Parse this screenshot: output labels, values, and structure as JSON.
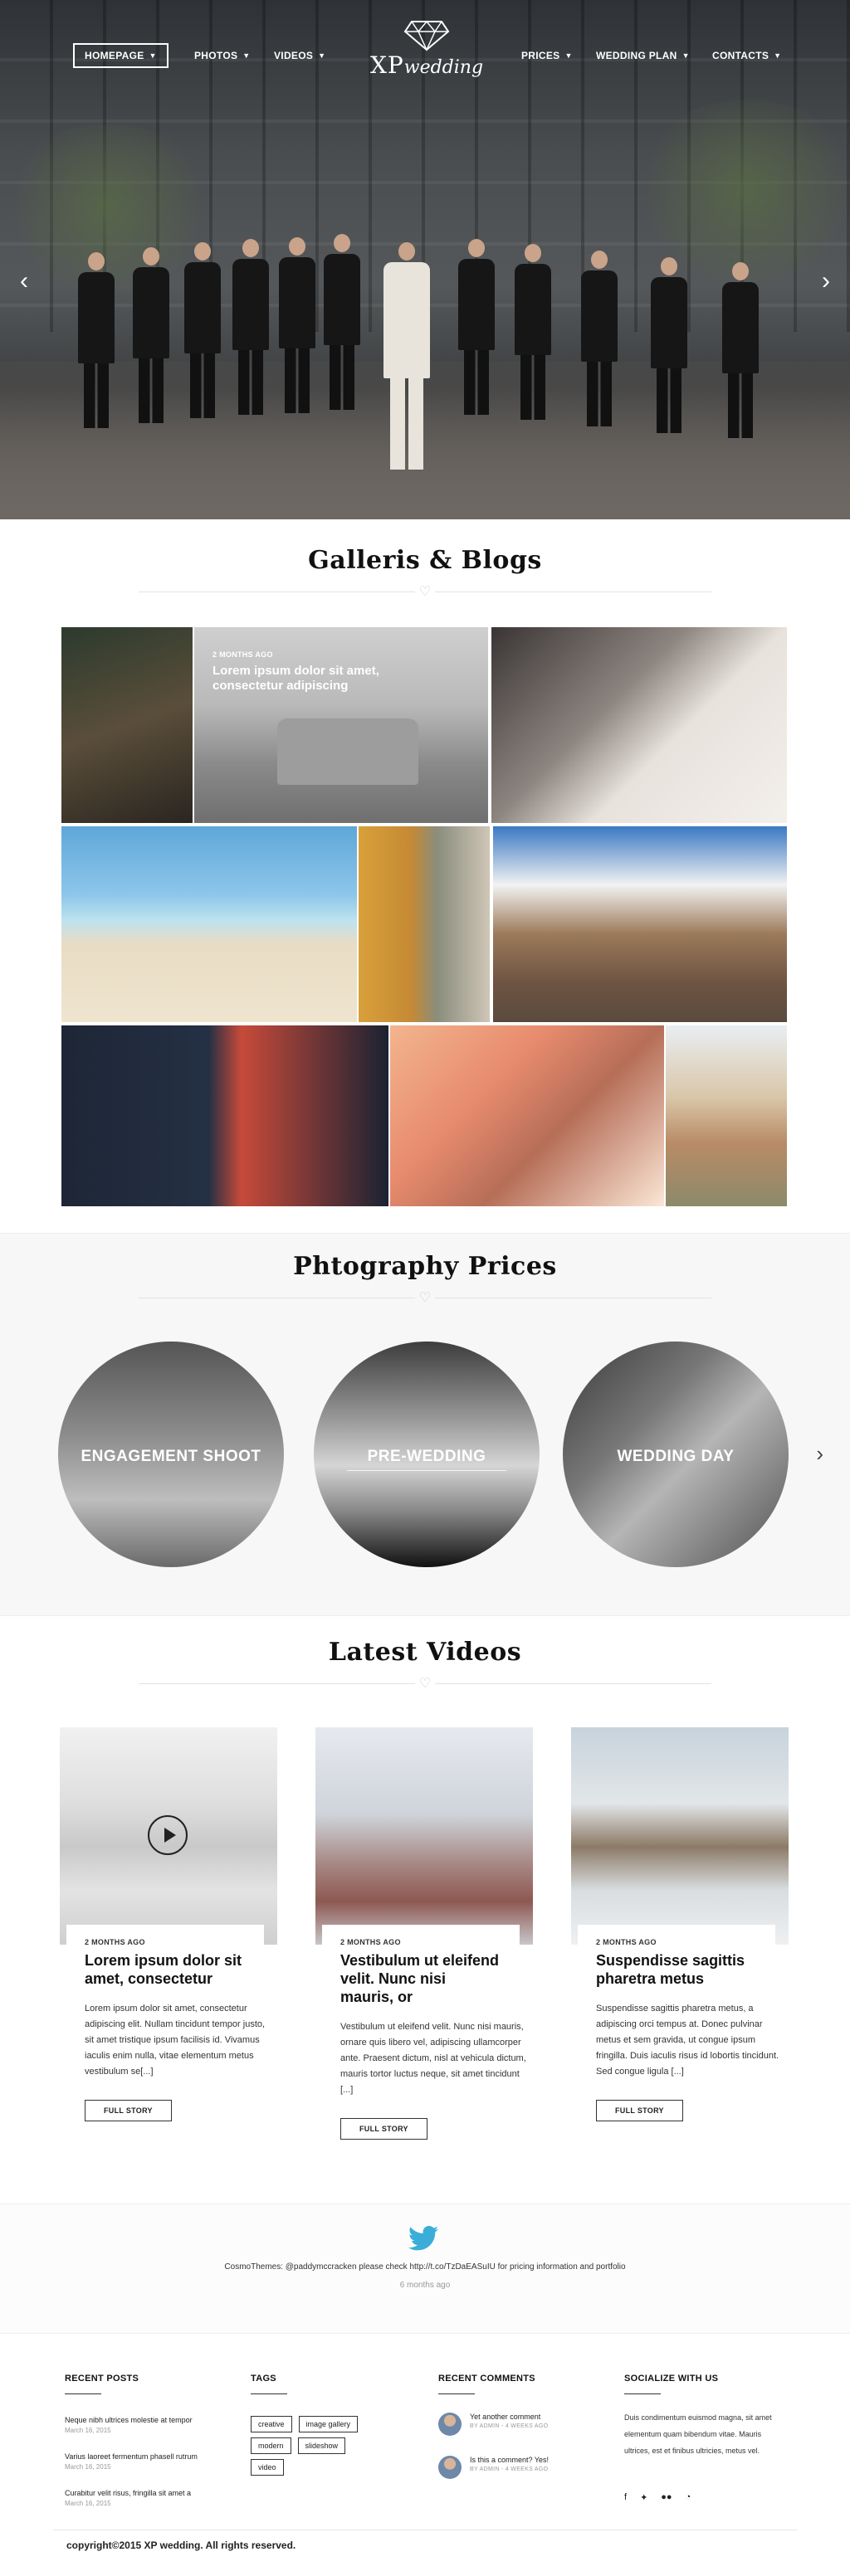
{
  "nav": {
    "left": [
      {
        "label": "HOMEPAGE",
        "active": true
      },
      {
        "label": "PHOTOS"
      },
      {
        "label": "VIDEOS"
      }
    ],
    "right": [
      {
        "label": "PRICES"
      },
      {
        "label": "WEDDING PLAN"
      },
      {
        "label": "CONTACTS"
      }
    ]
  },
  "logo": {
    "xp": "XP",
    "wedding": "wedding"
  },
  "hero": {
    "prev_icon": "chevron-left-icon",
    "next_icon": "chevron-right-icon"
  },
  "gallery": {
    "title": "Galleris & Blogs",
    "featured": {
      "date": "2 MONTHS AGO",
      "title": "Lorem ipsum dolor sit amet, consectetur adipiscing"
    }
  },
  "prices": {
    "title": "Phtography Prices",
    "items": [
      {
        "label": "ENGAGEMENT SHOOT"
      },
      {
        "label": "PRE-WEDDING"
      },
      {
        "label": "WEDDING DAY"
      }
    ],
    "next_icon": "chevron-right-icon"
  },
  "videos": {
    "title": "Latest Videos",
    "items": [
      {
        "date": "2 MONTHS AGO",
        "title": "Lorem ipsum dolor sit amet, consectetur",
        "text": "Lorem ipsum dolor sit amet, consectetur adipiscing elit. Nullam tincidunt tempor justo, sit amet tristique ipsum facilisis id. Vivamus iaculis enim nulla, vitae elementum metus vestibulum se[...]",
        "button": "FULL STORY"
      },
      {
        "date": "2 MONTHS AGO",
        "title": "Vestibulum ut eleifend velit. Nunc nisi mauris, or",
        "text": "Vestibulum ut eleifend velit. Nunc nisi mauris, ornare quis libero vel, adipiscing ullamcorper ante. Praesent dictum, nisl at vehicula dictum, mauris tortor luctus neque, sit amet tincidunt [...]",
        "button": "FULL STORY"
      },
      {
        "date": "2 MONTHS AGO",
        "title": "Suspendisse sagittis pharetra metus",
        "text": "Suspendisse sagittis pharetra metus, a adipiscing orci tempus at. Donec pulvinar metus et sem gravida, ut congue ipsum fringilla. Duis iaculis risus id lobortis tincidunt. Sed congue ligula [...]",
        "button": "FULL STORY"
      }
    ]
  },
  "tweet": {
    "icon": "twitter-icon",
    "text": "CosmoThemes: @paddymccracken please check http://t.co/TzDaEASuIU for pricing information and portfolio",
    "ago": "6 months ago"
  },
  "footer": {
    "recent_posts": {
      "heading": "RECENT POSTS",
      "items": [
        {
          "title": "Neque nibh ultrices molestie at tempor",
          "date": "March 16, 2015"
        },
        {
          "title": "Varius laoreet fermentum phasell rutrum",
          "date": "March 16, 2015"
        },
        {
          "title": "Curabitur velit risus, fringilla sit amet a",
          "date": "March 16, 2015"
        }
      ]
    },
    "tags": {
      "heading": "TAGS",
      "items": [
        "creative",
        "image gallery",
        "modern",
        "slideshow",
        "video"
      ]
    },
    "recent_comments": {
      "heading": "RECENT COMMENTS",
      "items": [
        {
          "title": "Yet another comment",
          "meta": "BY ADMIN  -  4 WEEKS AGO"
        },
        {
          "title": "Is this a comment? Yes!",
          "meta": "BY ADMIN  -  4 WEEKS AGO"
        }
      ]
    },
    "social": {
      "heading": "SOCIALIZE WITH US",
      "text": "Duis condimentum euismod magna, sit amet elementum quam bibendum vitae. Mauris ultrices, est et finibus ultricies, metus vel.",
      "icons": [
        "facebook-icon",
        "twitter-icon",
        "flickr-icon",
        "rss-icon"
      ]
    },
    "copyright": "copyright©2015 XP wedding. All rights reserved."
  }
}
